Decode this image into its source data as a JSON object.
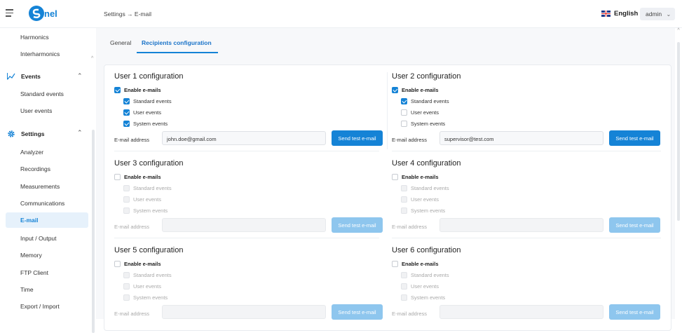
{
  "header": {
    "breadcrumb": "Settings → E-mail",
    "language": "English",
    "user": "admin"
  },
  "sidebar": {
    "items_top": [
      "Harmonics",
      "Interharmonics"
    ],
    "events": {
      "label": "Events",
      "items": [
        "Standard events",
        "User events"
      ]
    },
    "settings": {
      "label": "Settings",
      "items": [
        "Analyzer",
        "Recordings",
        "Measurements",
        "Communications",
        "E-mail",
        "Input / Output",
        "Memory",
        "FTP Client",
        "Time",
        "Export / Import"
      ]
    }
  },
  "tabs": [
    {
      "label": "General"
    },
    {
      "label": "Recipients configuration"
    }
  ],
  "common": {
    "enable": "Enable e-mails",
    "standard": "Standard events",
    "user": "User events",
    "system": "System events",
    "email_label": "E-mail address",
    "send_btn": "Send test e-mail"
  },
  "users": [
    {
      "title": "User 1 configuration",
      "enabled": true,
      "standard": true,
      "user": true,
      "system": true,
      "email": "john.doe@gmail.com"
    },
    {
      "title": "User 2 configuration",
      "enabled": true,
      "standard": true,
      "user": false,
      "system": false,
      "email": "supervisor@test.com"
    },
    {
      "title": "User 3 configuration",
      "enabled": false,
      "standard": false,
      "user": false,
      "system": false,
      "email": ""
    },
    {
      "title": "User 4 configuration",
      "enabled": false,
      "standard": false,
      "user": false,
      "system": false,
      "email": ""
    },
    {
      "title": "User 5 configuration",
      "enabled": false,
      "standard": false,
      "user": false,
      "system": false,
      "email": ""
    },
    {
      "title": "User 6 configuration",
      "enabled": false,
      "standard": false,
      "user": false,
      "system": false,
      "email": ""
    }
  ],
  "colors": {
    "accent": "#1583d6",
    "accent_disabled": "#8ec6ee"
  }
}
